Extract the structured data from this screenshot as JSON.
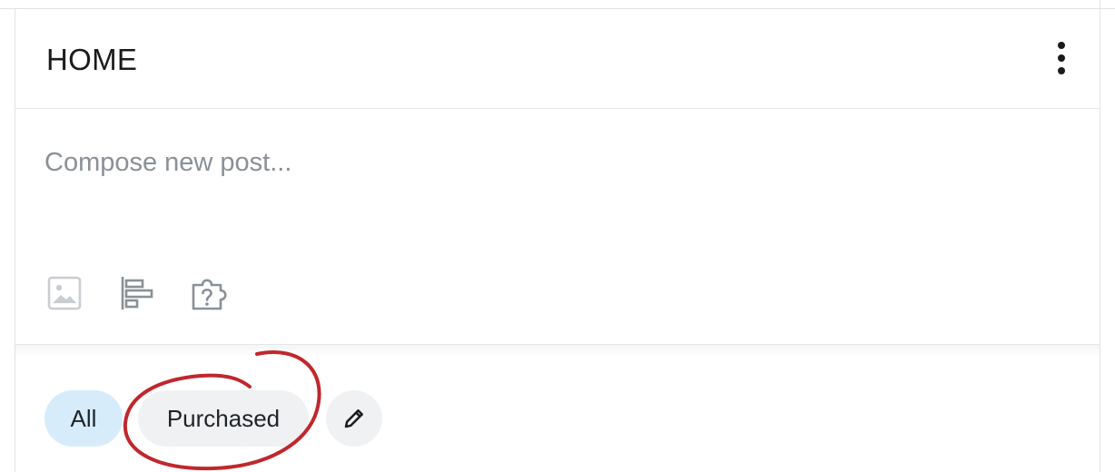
{
  "header": {
    "title": "HOME",
    "more_icon": "more-vertical-icon"
  },
  "composer": {
    "placeholder": "Compose new post...",
    "value": "",
    "tools": [
      {
        "icon": "image-icon"
      },
      {
        "icon": "poll-icon"
      },
      {
        "icon": "quiz-icon"
      }
    ]
  },
  "filters": {
    "chips": [
      {
        "label": "All",
        "selected": true
      },
      {
        "label": "Purchased",
        "selected": false
      }
    ],
    "edit_icon": "pencil-icon"
  },
  "annotation": {
    "shape": "hand-drawn-circle",
    "target": "Purchased",
    "color": "#c0272d"
  },
  "colors": {
    "selected_chip_bg": "#d6ecfb",
    "chip_bg": "#f0f1f2",
    "placeholder_text": "#8a9096",
    "icon_gray": "#8a9096",
    "divider": "#e2e3e5"
  }
}
